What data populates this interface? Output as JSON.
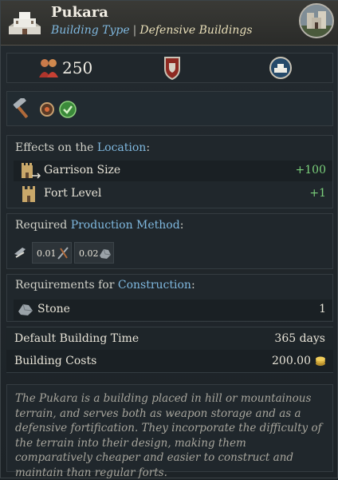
{
  "header": {
    "title": "Pukara",
    "type_key": "Building Type",
    "separator": "|",
    "type_value": "Defensive Buildings"
  },
  "stats": {
    "population": "250"
  },
  "effects": {
    "title_prefix": "Effects on the",
    "title_link": "Location",
    "title_suffix": ":",
    "items": [
      {
        "label": "Garrison Size",
        "value": "+100"
      },
      {
        "label": "Fort Level",
        "value": "+1"
      }
    ]
  },
  "production": {
    "title_prefix": "Required",
    "title_link": "Production Method",
    "title_suffix": ":",
    "inputs": [
      {
        "amount": "0.01"
      },
      {
        "amount": "0.02"
      }
    ]
  },
  "requirements": {
    "title_prefix": "Requirements for",
    "title_link": "Construction",
    "title_suffix": ":",
    "items": [
      {
        "label": "Stone",
        "value": "1"
      }
    ]
  },
  "build": {
    "time_label": "Default Building Time",
    "time_value": "365 days",
    "cost_label": "Building Costs",
    "cost_value": "200.00"
  },
  "description": "The Pukara is a building placed in hill or mountainous terrain, and serves both as weapon storage and as a defensive fortification. They incorporate the difficulty of the terrain into their design, making them comparatively cheaper and easier to construct and maintain than regular forts.",
  "colors": {
    "accent_link": "#7fb8df",
    "positive": "#7bd07b",
    "gold": "#e0b84a"
  }
}
